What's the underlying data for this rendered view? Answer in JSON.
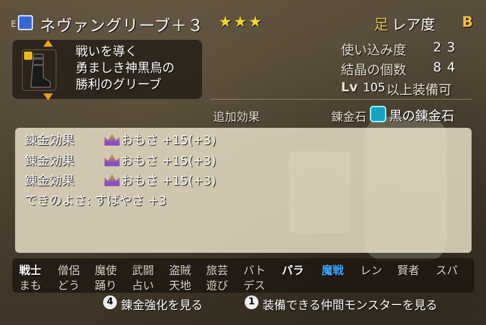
{
  "item": {
    "equip_mark": "E",
    "name": "ネヴァングリーブ＋３",
    "stars": "★★★",
    "slot_icon": "足",
    "rarity_label": "レア度",
    "rarity_value": "B",
    "icon": "boots-icon",
    "description": [
      "戦いを導く",
      "勇ましき神黒鳥の",
      "勝利のグリーブ"
    ]
  },
  "stats": {
    "usage_label": "使い込み度",
    "usage_value": "23",
    "crystal_label": "結晶の個数",
    "crystal_value": "84",
    "level_prefix": "Lv",
    "level_value": "105",
    "level_suffix": "以上装備可"
  },
  "effects": {
    "header": "追加効果",
    "stone_label": "錬金石",
    "stone_name": "黒の錬金石",
    "rows": [
      {
        "name": "錬金効果",
        "value": "おもさ  +15(+3)"
      },
      {
        "name": "錬金効果",
        "value": "おもさ  +15(+3)"
      },
      {
        "name": "錬金効果",
        "value": "おもさ  +15(+3)"
      }
    ],
    "bonus": "できのよさ:  すばやさ  +3"
  },
  "jobs": {
    "row1": [
      "戦士",
      "僧侶",
      "魔使",
      "武闘",
      "盗賊",
      "旅芸",
      "バト",
      "パラ",
      "魔戦",
      "レン",
      "賢者",
      "スパ"
    ],
    "row2": [
      "まも",
      "どう",
      "踊り",
      "占い",
      "天地",
      "遊び",
      "デス"
    ]
  },
  "footer": {
    "key1": "4",
    "action1": "錬金強化を見る",
    "key2": "1",
    "action2": "装備できる仲間モンスターを見る"
  },
  "colors": {
    "accent": "#f0c040",
    "highlight": "#40a8ff",
    "stars": "#f2d830"
  }
}
